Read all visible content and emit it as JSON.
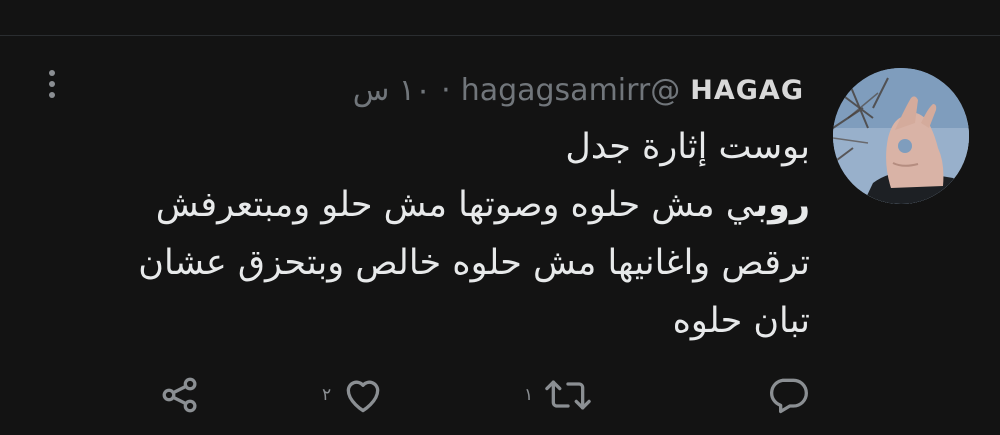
{
  "tweet": {
    "display_name": "HAGAG",
    "handle": "@hagagsamirr",
    "separator": "·",
    "time": "١٠ س",
    "text_lines": [
      "بوست إثارة جدل",
      "ي مش حلوه وصوتها مش حلو ومبتعرفش",
      "ترقص واغانيها مش حلوه خالص وبتحزق عشان",
      "تبان حلوه"
    ],
    "text_bold_word": "روب",
    "reply_count": "",
    "retweet_count": "١",
    "like_count": "٢"
  },
  "colors": {
    "background": "#131313",
    "text": "#e7e9ea",
    "muted": "#71767b",
    "icon": "#8b8f93"
  },
  "icons": {
    "reply": "speech-bubble-icon",
    "retweet": "retweet-arrows-icon",
    "like": "heart-icon",
    "share": "share-nodes-icon",
    "more": "vertical-dots-icon"
  }
}
